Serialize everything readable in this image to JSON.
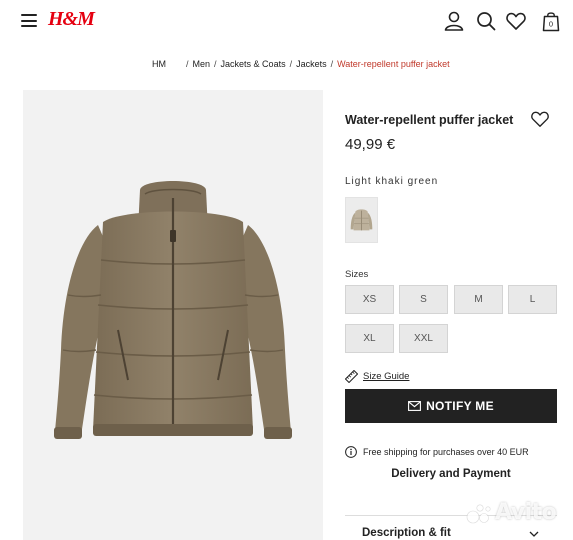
{
  "header": {
    "logo": "H&M",
    "icons": [
      "menu-icon",
      "account-icon",
      "search-icon",
      "favorites-icon",
      "shopping-bag-icon"
    ],
    "bag_count": "0",
    "brand_color": "#e50010"
  },
  "breadcrumb": {
    "items": [
      "HM",
      "Men",
      "Jackets & Coats",
      "Jackets"
    ],
    "current": "Water-repellent puffer jacket",
    "current_color": "#c0392b"
  },
  "product": {
    "title": "Water-repellent puffer jacket",
    "price": "49,99 €",
    "color_name": "Light khaki green",
    "jacket_color": "#8a7b62"
  },
  "sizes": {
    "label": "Sizes",
    "options": [
      "XS",
      "S",
      "M",
      "L",
      "XL",
      "XXL"
    ]
  },
  "actions": {
    "size_guide": "Size Guide",
    "notify": "NOTIFY ME"
  },
  "shipping": {
    "text": "Free shipping for purchases over 40 EUR",
    "delivery": "Delivery and Payment",
    "description": "Description & fit"
  },
  "watermark": {
    "text": "Avito"
  }
}
